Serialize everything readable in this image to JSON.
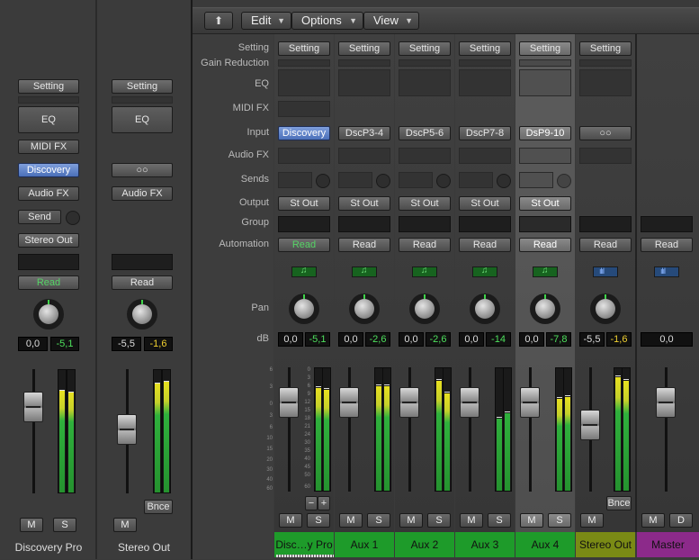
{
  "toolbar": {
    "edit": "Edit",
    "options": "Options",
    "view": "View"
  },
  "row_labels": {
    "setting": "Setting",
    "gain_reduction": "Gain Reduction",
    "eq": "EQ",
    "midi_fx": "MIDI FX",
    "input": "Input",
    "audio_fx": "Audio FX",
    "sends": "Sends",
    "output": "Output",
    "group": "Group",
    "automation": "Automation",
    "pan": "Pan",
    "db": "dB"
  },
  "inspector": {
    "left": {
      "setting": "Setting",
      "eq": "EQ",
      "midi_fx": "MIDI FX",
      "input": "Discovery",
      "audio_fx": "Audio FX",
      "send": "Send",
      "output": "Stereo Out",
      "automation": "Read",
      "vol": "0,0",
      "peak": "-5,1",
      "mute": "M",
      "solo": "S",
      "name": "Discovery Pro"
    },
    "right": {
      "setting": "Setting",
      "eq": "EQ",
      "audio_fx": "Audio FX",
      "automation": "Read",
      "vol": "-5,5",
      "peak": "-1,6",
      "bounce": "Bnce",
      "mute": "M",
      "name": "Stereo Out"
    }
  },
  "strips": [
    {
      "setting": "Setting",
      "input": "Discovery",
      "output": "St Out",
      "automation": "Read",
      "vol": "0,0",
      "peak": "-5,1",
      "mute": "M",
      "solo": "S",
      "name": "Disc…y Pro"
    },
    {
      "setting": "Setting",
      "input": "DscP3-4",
      "output": "St Out",
      "automation": "Read",
      "vol": "0,0",
      "peak": "-2,6",
      "mute": "M",
      "solo": "S",
      "name": "Aux 1"
    },
    {
      "setting": "Setting",
      "input": "DscP5-6",
      "output": "St Out",
      "automation": "Read",
      "vol": "0,0",
      "peak": "-2,6",
      "mute": "M",
      "solo": "S",
      "name": "Aux 2"
    },
    {
      "setting": "Setting",
      "input": "DscP7-8",
      "output": "St Out",
      "automation": "Read",
      "vol": "0,0",
      "peak": "-14",
      "mute": "M",
      "solo": "S",
      "name": "Aux 3"
    },
    {
      "setting": "Setting",
      "input": "DsP9-10",
      "output": "St Out",
      "automation": "Read",
      "vol": "0,0",
      "peak": "-7,8",
      "mute": "M",
      "solo": "S",
      "name": "Aux 4"
    },
    {
      "setting": "Setting",
      "input": "",
      "output": "",
      "automation": "Read",
      "vol": "-5,5",
      "peak": "-1,6",
      "mute": "M",
      "solo": "",
      "bounce": "Bnce",
      "name": "Stereo Out"
    },
    {
      "setting": "",
      "input": "",
      "output": "",
      "automation": "Read",
      "vol": "0,0",
      "peak": "",
      "mute": "M",
      "solo": "D",
      "name": "Master"
    }
  ],
  "fader_scale": [
    "6",
    "3",
    "0",
    "3",
    "6",
    "10",
    "15",
    "20",
    "30",
    "40",
    "60"
  ],
  "meter_scale": [
    "0",
    "3",
    "6",
    "9",
    "12",
    "15",
    "18",
    "21",
    "24",
    "30",
    "35",
    "40",
    "45",
    "50",
    "60"
  ],
  "colors": {
    "aux": "#1e9b2a",
    "stereo_out": "#7a8a15",
    "master": "#8c2a8a",
    "input_highlight": "#5a7fcc"
  }
}
